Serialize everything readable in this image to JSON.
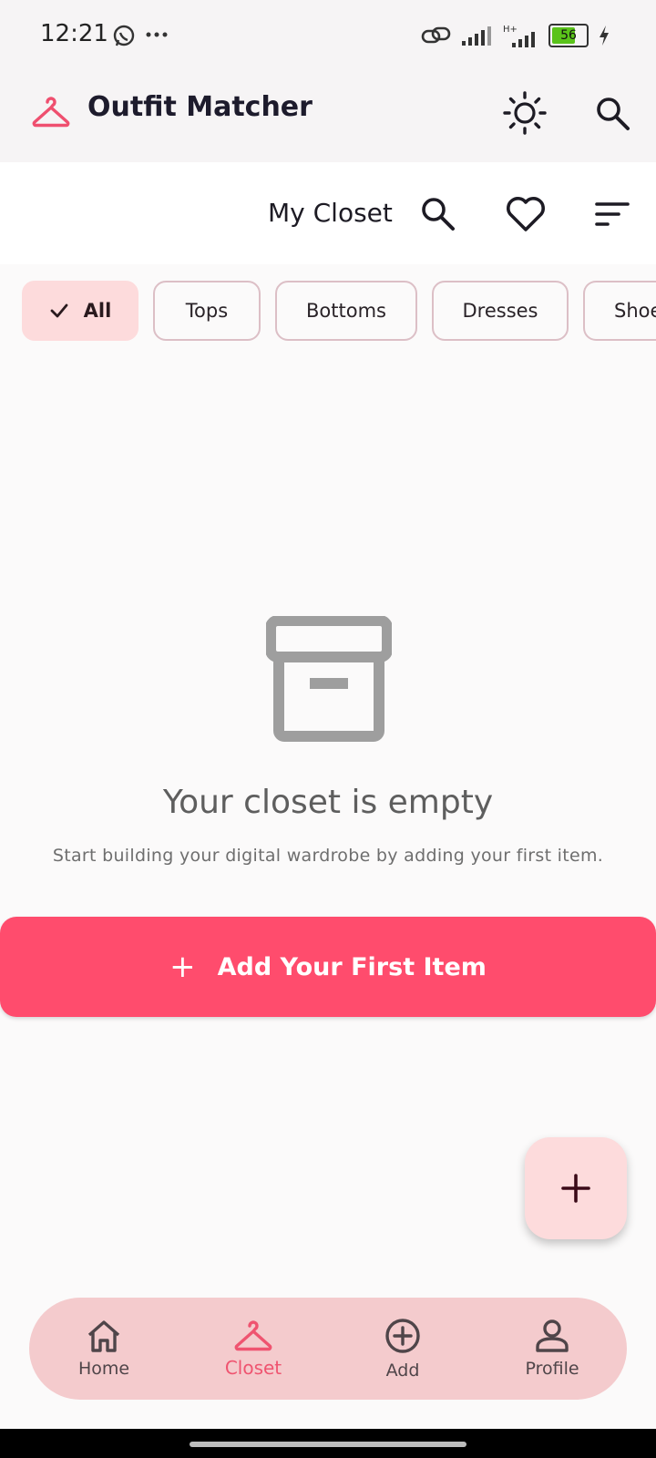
{
  "status_bar": {
    "time": "12:21",
    "battery": "56",
    "icons": [
      "whatsapp-icon",
      "more-dots-icon",
      "link-icon",
      "signal-icon",
      "signal-hplus-icon",
      "battery-icon",
      "charging-icon"
    ]
  },
  "app_bar": {
    "title": "Outfit Matcher",
    "icons": [
      "hanger-logo-icon",
      "brightness-icon",
      "search-icon"
    ]
  },
  "closet_header": {
    "title": "My Closet",
    "icons": [
      "search-icon",
      "heart-icon",
      "sort-icon"
    ]
  },
  "filters": {
    "chips": [
      "All",
      "Tops",
      "Bottoms",
      "Dresses",
      "Shoes"
    ],
    "selected": "All"
  },
  "empty_state": {
    "icon": "archive-box-icon",
    "title": "Your closet is empty",
    "subtitle": "Start building your digital wardrobe by adding your first item.",
    "button_label": "Add Your First Item"
  },
  "fab": {
    "icon": "plus-icon"
  },
  "bottom_nav": {
    "items": [
      {
        "label": "Home",
        "icon": "home-icon"
      },
      {
        "label": "Closet",
        "icon": "hanger-icon"
      },
      {
        "label": "Add",
        "icon": "add-circle-icon"
      },
      {
        "label": "Profile",
        "icon": "profile-icon"
      }
    ],
    "active": "Closet"
  },
  "colors": {
    "accent": "#ff4c6d",
    "chip_selected": "#fddbdc",
    "nav_background": "#f4cbcd",
    "active_nav": "#ef5470"
  }
}
